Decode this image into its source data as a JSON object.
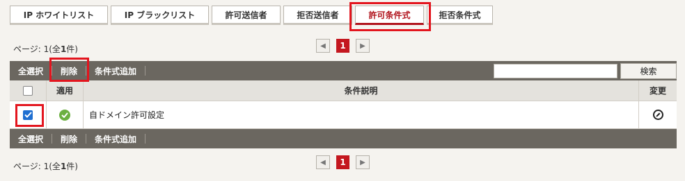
{
  "tabs": [
    {
      "label": "IP ホワイトリスト",
      "active": false
    },
    {
      "label": "IP ブラックリスト",
      "active": false
    },
    {
      "label": "許可送信者",
      "active": false
    },
    {
      "label": "拒否送信者",
      "active": false
    },
    {
      "label": "許可条件式",
      "active": true
    },
    {
      "label": "拒否条件式",
      "active": false
    }
  ],
  "pager": {
    "info_prefix": "ページ: 1(全",
    "info_count": "1",
    "info_suffix": "件)",
    "current_page": "1",
    "prev_icon": "chevron-left-icon",
    "next_icon": "chevron-right-icon"
  },
  "toolbar": {
    "select_all": "全選択",
    "delete": "削除",
    "add_condition": "条件式追加",
    "search_placeholder": "",
    "search_button": "検索"
  },
  "table": {
    "columns": [
      "",
      "適用",
      "条件説明",
      "変更"
    ],
    "rows": [
      {
        "checked": true,
        "applied": true,
        "description": "自ドメイン許可設定"
      }
    ]
  },
  "colors": {
    "accent_red": "#c4171f",
    "toolbar_bg": "#6b6760",
    "checkbox_blue": "#1f6fd1",
    "ok_green": "#6cb041"
  }
}
